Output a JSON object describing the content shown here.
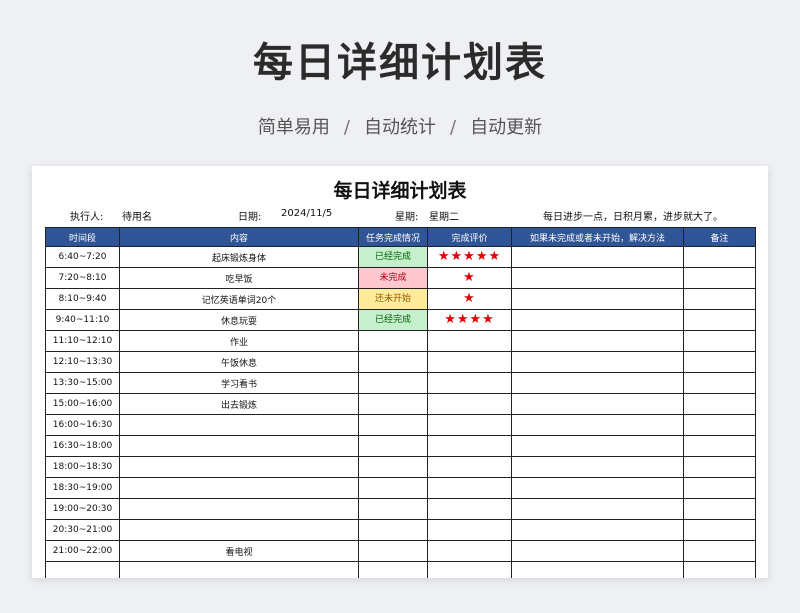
{
  "banner": {
    "title": "每日详细计划表",
    "subtitle_parts": [
      "简单易用",
      "自动统计",
      "自动更新"
    ],
    "separator": "/"
  },
  "sheet": {
    "title": "每日详细计划表",
    "executor_label": "执行人:",
    "executor_value": "待用名",
    "date_label": "日期:",
    "date_value": "2024/11/5",
    "weekday_label": "星期:",
    "weekday_value": "星期二",
    "motto": "每日进步一点，日积月累，进步就大了。"
  },
  "columns": [
    "时间段",
    "内容",
    "任务完成情况",
    "完成评价",
    "如果未完成或者未开始，解决方法",
    "备注"
  ],
  "status_colors": {
    "已经完成": {
      "bg": "#c6efce",
      "fg": "#006100"
    },
    "未完成": {
      "bg": "#ffc7ce",
      "fg": "#9c0006"
    },
    "还未开始": {
      "bg": "#ffeb9c",
      "fg": "#9c5700"
    }
  },
  "rows": [
    {
      "time": "6:40~7:20",
      "content": "起床锻炼身体",
      "status": "已经完成",
      "rating": "★★★★★",
      "solution": "",
      "note": ""
    },
    {
      "time": "7:20~8:10",
      "content": "吃早饭",
      "status": "未完成",
      "rating": "★",
      "solution": "",
      "note": ""
    },
    {
      "time": "8:10~9:40",
      "content": "记忆英语单词20个",
      "status": "还未开始",
      "rating": "★",
      "solution": "",
      "note": ""
    },
    {
      "time": "9:40~11:10",
      "content": "休息玩耍",
      "status": "已经完成",
      "rating": "★★★★",
      "solution": "",
      "note": ""
    },
    {
      "time": "11:10~12:10",
      "content": "作业",
      "status": "",
      "rating": "",
      "solution": "",
      "note": ""
    },
    {
      "time": "12:10~13:30",
      "content": "午饭休息",
      "status": "",
      "rating": "",
      "solution": "",
      "note": ""
    },
    {
      "time": "13:30~15:00",
      "content": "学习看书",
      "status": "",
      "rating": "",
      "solution": "",
      "note": ""
    },
    {
      "time": "15:00~16:00",
      "content": "出去锻炼",
      "status": "",
      "rating": "",
      "solution": "",
      "note": ""
    },
    {
      "time": "16:00~16:30",
      "content": "",
      "status": "",
      "rating": "",
      "solution": "",
      "note": ""
    },
    {
      "time": "16:30~18:00",
      "content": "",
      "status": "",
      "rating": "",
      "solution": "",
      "note": ""
    },
    {
      "time": "18:00~18:30",
      "content": "",
      "status": "",
      "rating": "",
      "solution": "",
      "note": ""
    },
    {
      "time": "18:30~19:00",
      "content": "",
      "status": "",
      "rating": "",
      "solution": "",
      "note": ""
    },
    {
      "time": "19:00~20:30",
      "content": "",
      "status": "",
      "rating": "",
      "solution": "",
      "note": ""
    },
    {
      "time": "20:30~21:00",
      "content": "",
      "status": "",
      "rating": "",
      "solution": "",
      "note": ""
    },
    {
      "time": "21:00~22:00",
      "content": "看电视",
      "status": "",
      "rating": "",
      "solution": "",
      "note": ""
    },
    {
      "time": "",
      "content": "",
      "status": "",
      "rating": "",
      "solution": "",
      "note": ""
    }
  ]
}
